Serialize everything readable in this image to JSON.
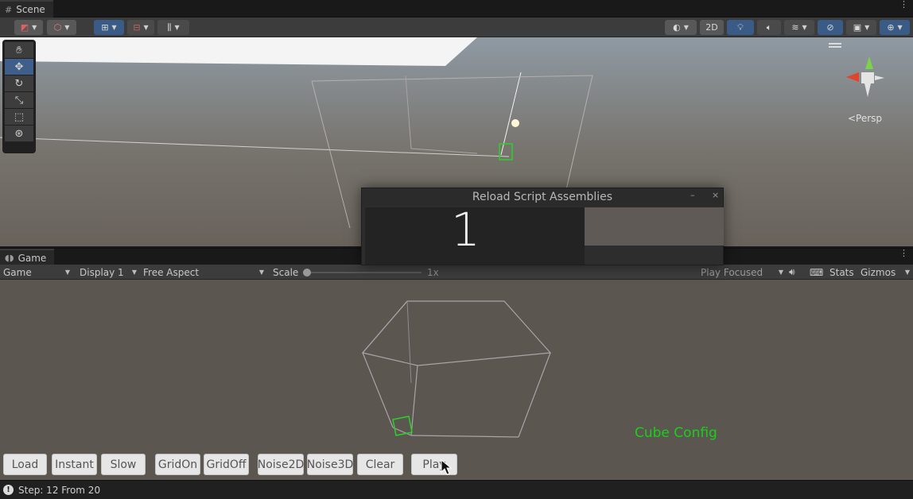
{
  "scene_tab": {
    "label": "Scene",
    "icon": "grid-icon"
  },
  "scene_toolbar": {
    "two_d_label": "2D"
  },
  "scene_view": {
    "projection_label": "<Persp"
  },
  "game_tab": {
    "label": "Game",
    "icon": "gamepad-icon"
  },
  "game_toolbar": {
    "mode": "Game",
    "display": "Display 1",
    "aspect": "Free Aspect",
    "scale_label": "Scale",
    "scale_value": "1x",
    "play_mode": "Play Focused",
    "stats_label": "Stats",
    "gizmos_label": "Gizmos"
  },
  "game_view": {
    "config_label": "Cube Config",
    "config_color": "#19d019",
    "background_color": "#5b5650"
  },
  "buttons": {
    "load": "Load",
    "instant": "Instant",
    "slow": "Slow",
    "grid_on": "GridOn",
    "grid_off": "GridOff",
    "noise2d": "Noise2D",
    "noise3d": "Noise3D",
    "clear": "Clear",
    "play": "Play"
  },
  "status_bar": {
    "text": "Step: 12 From 20"
  },
  "reload_dialog": {
    "title": "Reload Script Assemblies",
    "counter": "1",
    "minimize": "–",
    "close": "×"
  }
}
